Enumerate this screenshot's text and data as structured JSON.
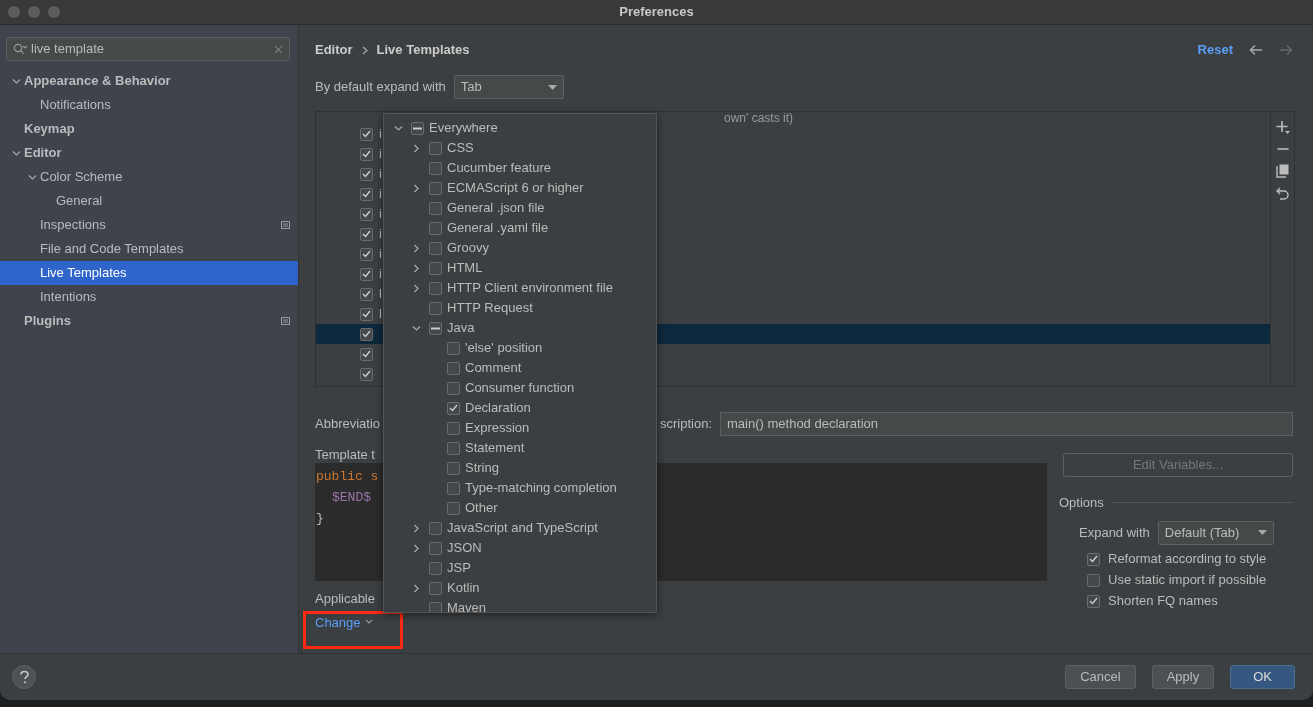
{
  "window": {
    "title": "Preferences"
  },
  "search": {
    "value": "live template"
  },
  "sidebar": {
    "items": [
      {
        "label": "Appearance & Behavior",
        "expanded": true,
        "scoped": false,
        "selected": false,
        "children": [
          {
            "label": "Notifications",
            "scoped": false,
            "selected": false
          }
        ]
      },
      {
        "label": "Keymap",
        "scoped": false,
        "selected": false
      },
      {
        "label": "Editor",
        "expanded": true,
        "scoped": false,
        "selected": false,
        "children": [
          {
            "label": "Color Scheme",
            "expanded": true,
            "scoped": false,
            "selected": false,
            "children": [
              {
                "label": "General",
                "scoped": false,
                "selected": false
              }
            ]
          },
          {
            "label": "Inspections",
            "scoped": true,
            "selected": false
          },
          {
            "label": "File and Code Templates",
            "scoped": false,
            "selected": false
          },
          {
            "label": "Live Templates",
            "scoped": false,
            "selected": true
          },
          {
            "label": "Intentions",
            "scoped": false,
            "selected": false
          }
        ]
      },
      {
        "label": "Plugins",
        "scoped": true,
        "selected": false
      }
    ]
  },
  "breadcrumb": [
    "Editor",
    "Live Templates"
  ],
  "reset": "Reset",
  "expand_default": {
    "label": "By default expand with",
    "value": "Tab"
  },
  "templates": {
    "first_description": "own' casts it)",
    "rows": [
      {
        "abbr": "i",
        "checked": true,
        "selected": false
      },
      {
        "abbr": "i",
        "checked": true,
        "selected": false
      },
      {
        "abbr": "i",
        "checked": true,
        "selected": false
      },
      {
        "abbr": "i",
        "checked": true,
        "selected": false
      },
      {
        "abbr": "i",
        "checked": true,
        "selected": false
      },
      {
        "abbr": "i",
        "checked": true,
        "selected": false
      },
      {
        "abbr": "i",
        "checked": true,
        "selected": false
      },
      {
        "abbr": "i",
        "checked": true,
        "selected": false
      },
      {
        "abbr": "l",
        "checked": true,
        "selected": false
      },
      {
        "abbr": "l",
        "checked": true,
        "selected": false
      },
      {
        "checked": true,
        "selected": true
      },
      {
        "checked": true,
        "selected": false
      },
      {
        "checked": true,
        "selected": false
      }
    ]
  },
  "abbreviation_label": "Abbreviatio",
  "description": {
    "label": "scription:",
    "value": "main() method declaration"
  },
  "template_text": {
    "label": "Template t",
    "lines": [
      {
        "kind": "keyword",
        "text": "public s"
      },
      {
        "kind": "variable",
        "text": "$END$"
      },
      {
        "kind": "plain",
        "text": "}"
      }
    ]
  },
  "applicable_label": "Applicable",
  "change_link": "Change",
  "edit_variables": {
    "label": "Edit Variables...",
    "disabled": true
  },
  "options": {
    "title": "Options",
    "expand_label": "Expand with",
    "expand_value": "Default (Tab)",
    "checks": [
      {
        "label": "Reformat according to style",
        "checked": true
      },
      {
        "label": "Use static import if possible",
        "checked": false
      },
      {
        "label": "Shorten FQ names",
        "checked": true
      }
    ]
  },
  "buttons": [
    {
      "label": "Cancel",
      "primary": false
    },
    {
      "label": "Apply",
      "primary": false
    },
    {
      "label": "OK",
      "primary": true
    }
  ],
  "contexts": [
    {
      "label": "Everywhere",
      "expanded": true,
      "mixed": true,
      "children": [
        {
          "label": "CSS",
          "expanded": false,
          "checked": false,
          "mixed": false
        },
        {
          "label": "Cucumber feature",
          "checked": false,
          "mixed": false
        },
        {
          "label": "ECMAScript 6 or higher",
          "expanded": false,
          "checked": false,
          "mixed": false
        },
        {
          "label": "General .json file",
          "checked": false,
          "mixed": false
        },
        {
          "label": "General .yaml file",
          "checked": false,
          "mixed": false
        },
        {
          "label": "Groovy",
          "expanded": false,
          "checked": false,
          "mixed": false
        },
        {
          "label": "HTML",
          "expanded": false,
          "checked": false,
          "mixed": false
        },
        {
          "label": "HTTP Client environment file",
          "expanded": false,
          "checked": false,
          "mixed": false
        },
        {
          "label": "HTTP Request",
          "checked": false,
          "mixed": false
        },
        {
          "label": "Java",
          "expanded": true,
          "mixed": true,
          "children": [
            {
              "label": "'else' position",
              "checked": false,
              "mixed": false
            },
            {
              "label": "Comment",
              "checked": false,
              "mixed": false
            },
            {
              "label": "Consumer function",
              "checked": false,
              "mixed": false
            },
            {
              "label": "Declaration",
              "checked": true,
              "mixed": false
            },
            {
              "label": "Expression",
              "checked": false,
              "mixed": false
            },
            {
              "label": "Statement",
              "checked": false,
              "mixed": false
            },
            {
              "label": "String",
              "checked": false,
              "mixed": false
            },
            {
              "label": "Type-matching completion",
              "checked": false,
              "mixed": false
            },
            {
              "label": "Other",
              "checked": false,
              "mixed": false
            }
          ]
        },
        {
          "label": "JavaScript and TypeScript",
          "expanded": false,
          "checked": false,
          "mixed": false
        },
        {
          "label": "JSON",
          "expanded": false,
          "checked": false,
          "mixed": false
        },
        {
          "label": "JSP",
          "checked": false,
          "mixed": false
        },
        {
          "label": "Kotlin",
          "expanded": false,
          "checked": false,
          "mixed": false
        },
        {
          "label": "Maven",
          "checked": false,
          "mixed": false
        }
      ]
    }
  ]
}
